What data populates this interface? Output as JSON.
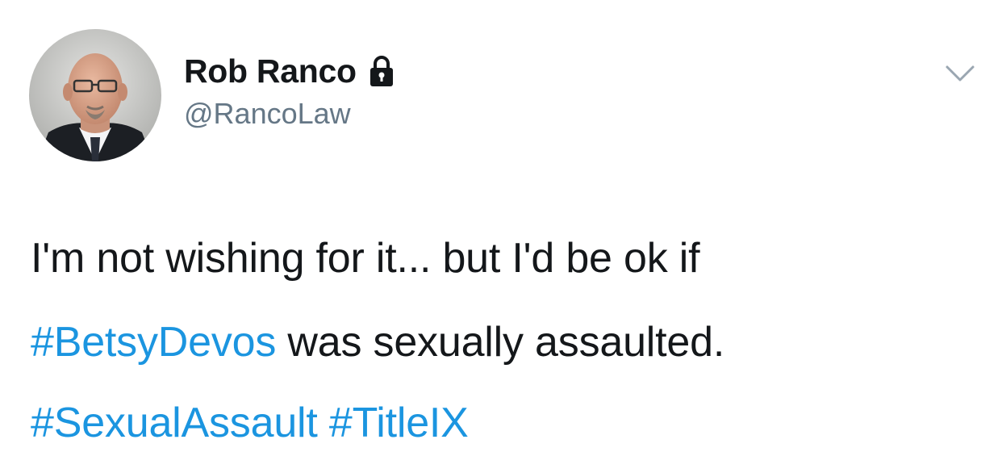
{
  "author": {
    "display_name": "Rob Ranco",
    "handle": "@RancoLaw",
    "protected_icon": "lock-icon",
    "avatar_icon": "profile-photo"
  },
  "tweet": {
    "line1": "I'm not wishing for it... but I'd be ok if",
    "line2_hashtag": "#BetsyDevos",
    "line2_rest": " was sexually assaulted.",
    "hashtag1": "#SexualAssault",
    "hashtag2": "#TitleIX"
  },
  "menu_icon": "chevron-down-icon",
  "colors": {
    "text": "#14171a",
    "secondary": "#657786",
    "link": "#1b95e0",
    "background": "#ffffff"
  }
}
